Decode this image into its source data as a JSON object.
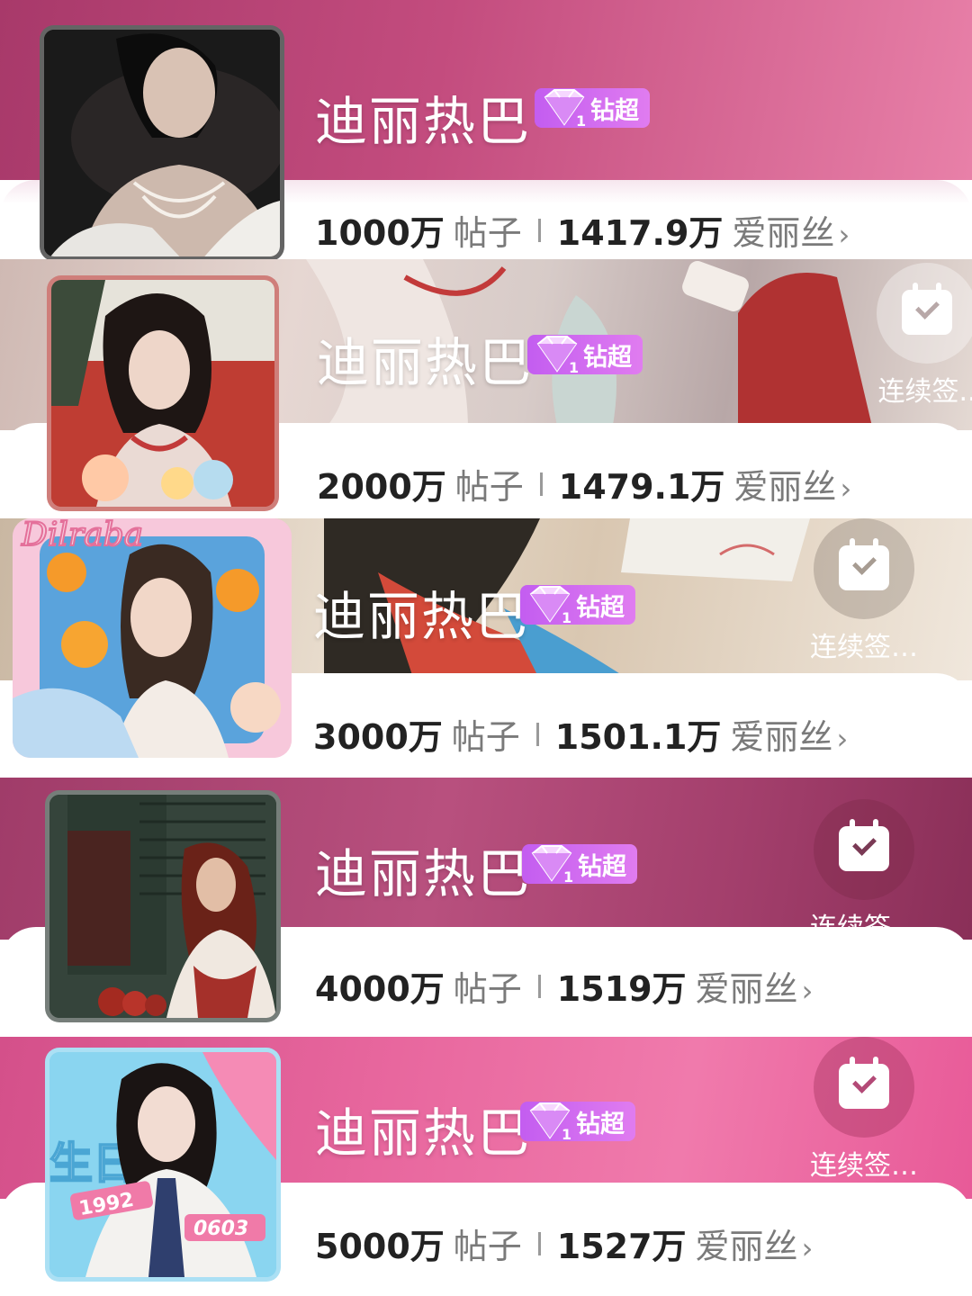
{
  "badge_label": "钻超",
  "checkin_label": "连续签…",
  "checkin_label_short": "连续签..",
  "posts_label": "帖子",
  "fans_label": "爱丽丝",
  "chevron": "›",
  "colors": {
    "card1": "#c34c7e",
    "card2": "#d9c9c4",
    "card3": "#e7d7c9",
    "card4": "#a33f6c",
    "card5": "#e8679e",
    "badge": "#c35df0"
  },
  "cards": [
    {
      "name": "迪丽热巴",
      "posts": "1000万",
      "fans": "1417.9万",
      "has_checkin": false
    },
    {
      "name": "迪丽热巴",
      "posts": "2000万",
      "fans": "1479.1万",
      "has_checkin": true
    },
    {
      "name": "迪丽热巴",
      "posts": "3000万",
      "fans": "1501.1万",
      "has_checkin": true
    },
    {
      "name": "迪丽热巴",
      "posts": "4000万",
      "fans": "1519万",
      "has_checkin": true
    },
    {
      "name": "迪丽热巴",
      "posts": "5000万",
      "fans": "1527万",
      "has_checkin": true
    }
  ],
  "avatar3_text": "Dilraba",
  "avatar5_texts": [
    "1992",
    "0603"
  ]
}
